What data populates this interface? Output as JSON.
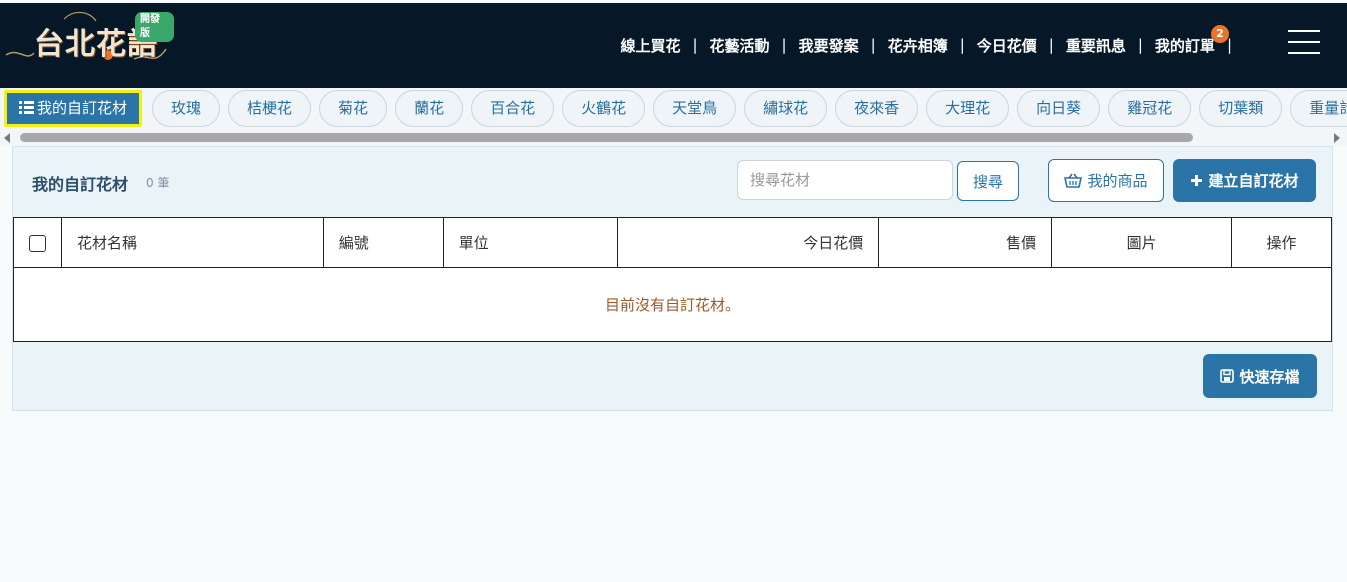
{
  "header": {
    "logo_text": "台北花語",
    "dev_badge": "開發版",
    "nav": [
      "線上買花",
      "花藝活動",
      "我要發案",
      "花卉相簿",
      "今日花價",
      "重要訊息",
      "我的訂單"
    ],
    "order_badge": "2"
  },
  "categories": {
    "active": "我的自訂花材",
    "items": [
      "玫瑰",
      "桔梗花",
      "菊花",
      "蘭花",
      "百合花",
      "火鶴花",
      "天堂鳥",
      "繡球花",
      "夜來香",
      "大理花",
      "向日葵",
      "雞冠花",
      "切葉類",
      "重量計花"
    ]
  },
  "panel": {
    "title": "我的自訂花材",
    "count": "0 筆",
    "search_placeholder": "搜尋花材",
    "search_button": "搜尋",
    "my_products_button": "我的商品",
    "create_button": "建立自訂花材",
    "save_button": "快速存檔"
  },
  "table": {
    "headers": [
      "花材名稱",
      "編號",
      "單位",
      "今日花價",
      "售價",
      "圖片",
      "操作"
    ],
    "empty_message": "目前沒有自訂花材。"
  },
  "colors": {
    "header_bg": "#061727",
    "accent": "#2a74a8",
    "highlight": "#f2ef16",
    "badge": "#e8742a"
  }
}
